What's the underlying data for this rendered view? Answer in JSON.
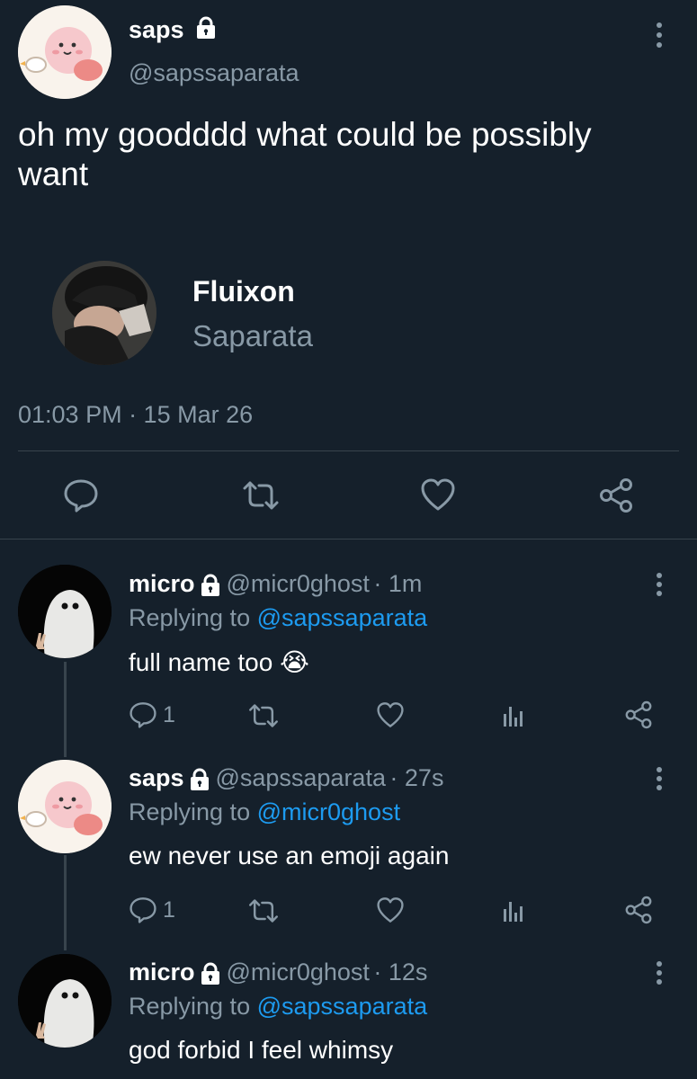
{
  "tweet": {
    "author_name": "saps",
    "author_handle": "@sapssaparata",
    "text": "oh my goodddd what could be possibly want",
    "card": {
      "title": "Fluixon",
      "subtitle": "Saparata"
    },
    "timestamp": "01:03 PM · 15 Mar 26",
    "actions": [
      "reply-icon",
      "retweet-icon",
      "like-icon",
      "share-icon"
    ]
  },
  "replies": [
    {
      "name": "micro",
      "handle": "@micr0ghost",
      "time": "· 1m",
      "replying_prefix": "Replying to",
      "replying_to": "@sapssaparata",
      "text": "full name too",
      "emoji": "😭",
      "reply_count": "1"
    },
    {
      "name": "saps",
      "handle": "@sapssaparata",
      "time": "· 27s",
      "replying_prefix": "Replying to",
      "replying_to": "@micr0ghost",
      "text": "ew never use an emoji again",
      "reply_count": "1"
    },
    {
      "name": "micro",
      "handle": "@micr0ghost",
      "time": "· 12s",
      "replying_prefix": "Replying to",
      "replying_to": "@sapssaparata",
      "text": "god forbid I feel whimsy"
    }
  ],
  "colors": {
    "background": "#15202b",
    "muted": "#8899a6",
    "link": "#1d9bf0",
    "divider": "#38444d"
  }
}
